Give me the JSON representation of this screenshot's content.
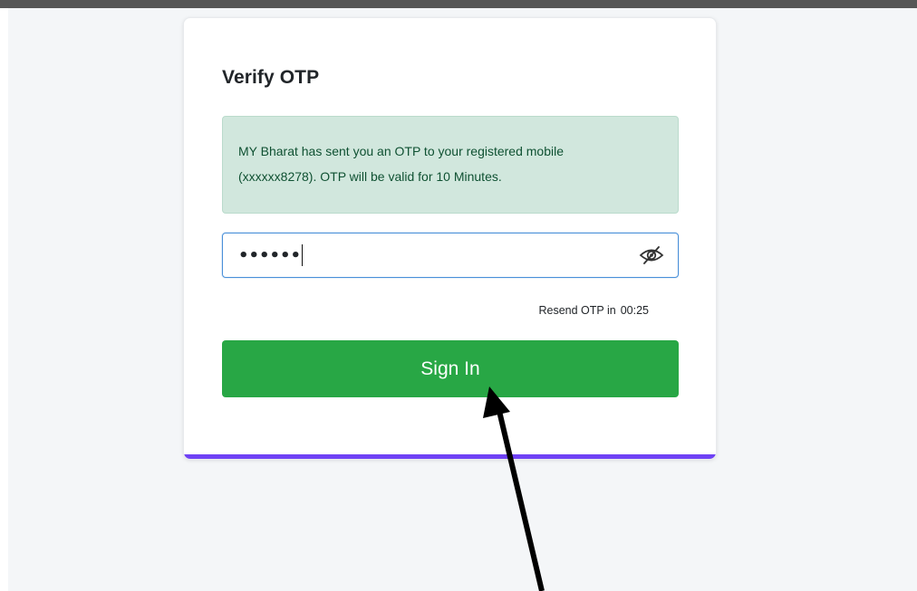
{
  "page": {
    "background_color": "#f4f6f8",
    "top_bar_color": "#575757"
  },
  "card": {
    "title": "Verify OTP",
    "accent_color": "#6f42f5"
  },
  "alert": {
    "line1": "MY Bharat has sent you an OTP to your registered mobile",
    "line2": "(xxxxxx8278). OTP will be valid for 10 Minutes.",
    "background_color": "#d1e7dd",
    "text_color": "#0f5132"
  },
  "otp_input": {
    "masked_value": "••••••",
    "visibility_icon": "eye-slash-icon"
  },
  "resend": {
    "label": "Resend OTP in",
    "countdown": "00:25"
  },
  "signin_button": {
    "label": "Sign In",
    "color": "#28a745"
  },
  "annotation": {
    "icon": "arrow-up-icon"
  }
}
